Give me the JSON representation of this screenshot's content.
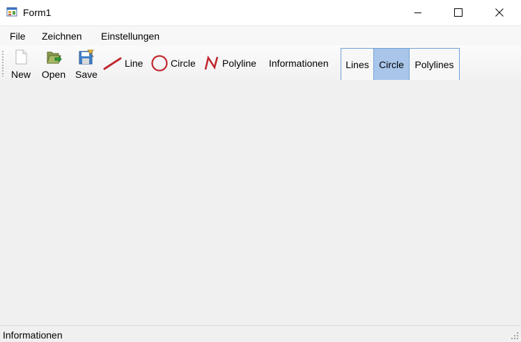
{
  "window": {
    "title": "Form1",
    "icon": "form-app-icon"
  },
  "menu": {
    "items": [
      "File",
      "Zeichnen",
      "Einstellungen"
    ]
  },
  "toolbar": {
    "new_label": "New",
    "open_label": "Open",
    "save_label": "Save",
    "line_label": "Line",
    "circle_label": "Circle",
    "polyline_label": "Polyline",
    "info_label": "Informationen",
    "tabs": [
      {
        "label": "Lines",
        "selected": false
      },
      {
        "label": "Circle",
        "selected": true
      },
      {
        "label": "Polylines",
        "selected": false
      }
    ]
  },
  "status": {
    "text": "Informationen"
  },
  "colors": {
    "accent_border": "#6e9fd6",
    "selected_tab": "#a9c6ea",
    "shape_red": "#c0282d"
  }
}
